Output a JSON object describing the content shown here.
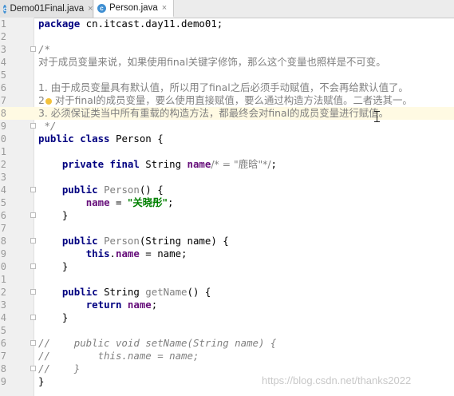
{
  "tabs": [
    {
      "label": "Demo01Final.java",
      "icon": "java-class-icon",
      "close": "×"
    },
    {
      "label": "Person.java",
      "icon": "java-class-icon",
      "close": "×"
    }
  ],
  "colors": {
    "keyword": "#000080",
    "field": "#660e7a",
    "string": "#008000",
    "comment": "#808080",
    "current_line": "#fffae3"
  },
  "code": {
    "l1_pkg": "package",
    "l1_name": " cn.itcast.day11.demo01;",
    "l3": "/*",
    "l4": "对于成员变量来说，如果使用final关键字修饰，那么这个变量也照样是不可变。",
    "l6": "1. 由于成员变量具有默认值，所以用了final之后必须手动赋值，不会再给默认值了。",
    "l7_num": "2",
    "l7_text": " 对于final的成员变量，要么使用直接赋值，要么通过构造方法赋值。二者选其一。",
    "l8": "3. 必须保证类当中所有重载的构造方法，都最终会对final的成员变量进行赋值。",
    "l9": " */",
    "l10_kw": "public class",
    "l10_rest": " Person {",
    "l12_kw": "private final",
    "l12_type": " String ",
    "l12_field": "name",
    "l12_cmt": "/* = \"鹿晗\"*/",
    "l12_end": ";",
    "l14_kw": "public",
    "l14_name": " Person",
    "l14_rest": "() {",
    "l15_field": "name",
    "l15_eq": " = ",
    "l15_str": "\"关晓彤\"",
    "l15_end": ";",
    "close_brace": "}",
    "l18_kw": "public",
    "l18_name": " Person",
    "l18_rest": "(String name) {",
    "l19_this": "this",
    "l19_dot": ".",
    "l19_field": "name",
    "l19_rest": " = name;",
    "l22_kw": "public",
    "l22_type": " String ",
    "l22_name": "getName",
    "l22_rest": "() {",
    "l23_kw": "return",
    "l23_field": " name",
    "l23_end": ";",
    "l26": "//    public void setName(String name) {",
    "l27": "//        this.name = name;",
    "l28": "//    }",
    "l29": "}"
  },
  "watermark": "https://blog.csdn.net/thanks2022"
}
